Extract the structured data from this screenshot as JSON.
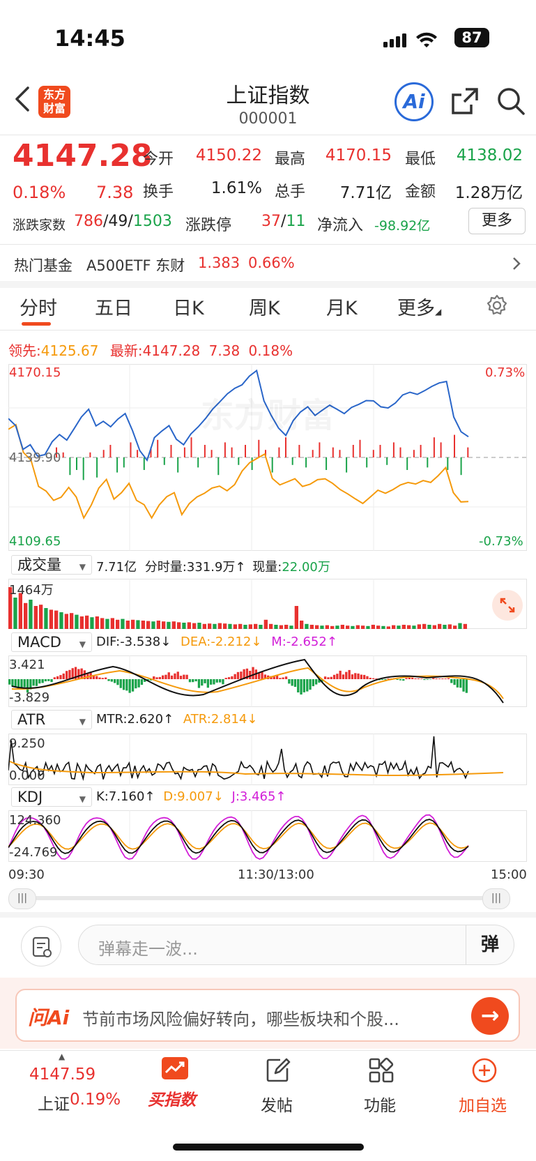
{
  "status": {
    "time": "14:45",
    "battery": "87"
  },
  "header": {
    "title": "上证指数",
    "code": "000001",
    "logo_line1": "东方",
    "logo_line2": "财富",
    "ai_label": "Ai"
  },
  "quote": {
    "price": "4147.28",
    "pct": "0.18%",
    "change": "7.38",
    "open_label": "今开",
    "open": "4150.22",
    "high_label": "最高",
    "high": "4170.15",
    "low_label": "最低",
    "low": "4138.02",
    "turnover_label": "换手",
    "turnover": "1.61%",
    "vol_label": "总手",
    "vol": "7.71亿",
    "amount_label": "金额",
    "amount": "1.28万亿",
    "breadth_label": "涨跌家数",
    "up": "786",
    "flat": "49",
    "down": "1503",
    "limit_label": "涨跌停",
    "limit_up": "37",
    "limit_down": "11",
    "netflow_label": "净流入",
    "netflow": "-98.92亿",
    "more_label": "更多"
  },
  "fund": {
    "label": "热门基金",
    "name": "A500ETF 东财",
    "price": "1.383",
    "pct": "0.66%"
  },
  "tabs": [
    "分时",
    "五日",
    "日K",
    "周K",
    "月K",
    "更多"
  ],
  "chart_header": {
    "lead_label": "领先:",
    "lead": "4125.67",
    "latest_label": "最新:",
    "latest": "4147.28",
    "change": "7.38",
    "pct": "0.18%"
  },
  "chart_data": {
    "type": "line",
    "title": "",
    "y_max": "4170.15",
    "y_min": "4109.65",
    "y_mid": "4139.90",
    "pct_max": "0.73%",
    "pct_min": "-0.73%",
    "ylim": [
      4109.65,
      4170.15
    ],
    "prev_close": 4139.9,
    "x_ticks": [
      "09:30",
      "11:30/13:00",
      "15:00"
    ],
    "series": [
      {
        "name": "最新",
        "color": "#2a66c9",
        "values": [
          4152.5,
          4150.2,
          4142.5,
          4144.0,
          4140.3,
          4140.8,
          4145.0,
          4147.3,
          4145.5,
          4149.2,
          4153.0,
          4155.5,
          4150.1,
          4151.6,
          4149.8,
          4152.3,
          4154.1,
          4148.6,
          4142.1,
          4139.0,
          4146.3,
          4148.4,
          4150.2,
          4145.8,
          4144.0,
          4147.5,
          4149.8,
          4152.5,
          4155.6,
          4158.0,
          4160.5,
          4162.3,
          4163.4,
          4166.2,
          4168.0,
          4158.2,
          4153.5,
          4149.4,
          4147.0,
          4151.8,
          4154.6,
          4156.3,
          4153.5,
          4155.2,
          4156.8,
          4155.5,
          4154.1,
          4156.1,
          4157.1,
          4158.3,
          4158.2,
          4156.3,
          4155.9,
          4157.5,
          4160.1,
          4161.0,
          4160.3,
          4161.5,
          4162.9,
          4164.0,
          4164.5,
          4153.0,
          4148.2,
          4146.6
        ]
      },
      {
        "name": "领先",
        "color": "#f59a0c",
        "values": [
          4149.0,
          4150.5,
          4141.5,
          4139.0,
          4130.5,
          4129.0,
          4126.0,
          4127.0,
          4130.2,
          4127.1,
          4120.3,
          4124.5,
          4130.0,
          4132.8,
          4126.4,
          4128.5,
          4131.5,
          4126.0,
          4124.6,
          4120.3,
          4124.5,
          4127.2,
          4128.5,
          4121.4,
          4125.0,
          4127.1,
          4128.3,
          4130.0,
          4130.6,
          4129.1,
          4131.1,
          4135.5,
          4138.2,
          4139.6,
          4141.0,
          4133.1,
          4131.0,
          4132.0,
          4133.0,
          4130.5,
          4131.2,
          4132.7,
          4133.0,
          4131.5,
          4129.5,
          4128.1,
          4126.5,
          4125.0,
          4127.1,
          4129.3,
          4128.3,
          4129.5,
          4131.0,
          4131.8,
          4131.3,
          4132.4,
          4131.8,
          4134.0,
          4136.6,
          4128.5,
          4125.5,
          4125.6
        ]
      }
    ],
    "flow_bars": [
      0.4,
      0.2,
      -0.7,
      -0.5,
      -0.9,
      0.2,
      -0.8,
      0.3,
      0.5,
      -0.6,
      -0.4,
      0.6,
      0.3,
      -0.5,
      0.4,
      0.7,
      -0.3,
      0.5,
      -0.6,
      0.4,
      0.8,
      -0.4,
      0.5,
      0.3,
      -0.7,
      0.6,
      0.4,
      -0.3,
      0.5,
      -0.5,
      0.7,
      0.3,
      -0.6,
      0.4,
      0.8,
      -0.3,
      0.5,
      -0.4,
      0.3,
      0.6,
      -0.5,
      0.4,
      0.3,
      -0.6,
      0.5,
      0.7,
      -0.4,
      0.3,
      0.5,
      -0.3,
      0.6,
      0.4,
      -0.5,
      0.3,
      0.5,
      -0.4,
      0.8,
      0.6,
      -0.5,
      0.9,
      -0.7,
      0.4
    ]
  },
  "volume": {
    "select": "成交量",
    "total": "7.71亿",
    "label_minute": "分时量:",
    "minute": "331.9万",
    "label_now": "现量:",
    "now": "22.00万",
    "max_label": "1464万",
    "bars": [
      1.0,
      0.75,
      0.86,
      0.62,
      0.7,
      0.55,
      0.58,
      0.5,
      0.46,
      0.44,
      0.4,
      0.36,
      0.38,
      0.34,
      0.3,
      0.32,
      0.28,
      0.3,
      0.26,
      0.24,
      0.26,
      0.22,
      0.24,
      0.2,
      0.22,
      0.21,
      0.2,
      0.19,
      0.18,
      0.2,
      0.18,
      0.17,
      0.18,
      0.16,
      0.15,
      0.16,
      0.14,
      0.15,
      0.12,
      0.13,
      0.12,
      0.14,
      0.13,
      0.12,
      0.11,
      0.12,
      0.1,
      0.11,
      0.12,
      0.1,
      0.22,
      0.12,
      0.1,
      0.09,
      0.1,
      0.08,
      0.55,
      0.2,
      0.12,
      0.1,
      0.09,
      0.08,
      0.09,
      0.07,
      0.08,
      0.1,
      0.08,
      0.07,
      0.09,
      0.08,
      0.07,
      0.1,
      0.08,
      0.07,
      0.06,
      0.09,
      0.08,
      0.1,
      0.09,
      0.08,
      0.11,
      0.12,
      0.1,
      0.09,
      0.12,
      0.1,
      0.11,
      0.08,
      0.14,
      0.12
    ]
  },
  "macd": {
    "select": "MACD",
    "dif": "DIF:-3.538",
    "dea": "DEA:-2.212",
    "m": "M:-2.652",
    "top": "3.421",
    "bottom": "-3.829",
    "hist": [
      -0.5,
      -0.7,
      -0.9,
      -0.6,
      -0.3,
      0.3,
      0.6,
      0.8,
      0.7,
      0.5,
      0.2,
      -0.3,
      -0.7,
      -0.9,
      -0.6,
      -0.2,
      0.3,
      0.6,
      0.5,
      0.3,
      -0.2,
      -0.6,
      -0.8,
      -0.5,
      0.2,
      0.5,
      0.7,
      0.8,
      0.6,
      0.4,
      0.2,
      -0.5,
      -1.0,
      -0.8,
      -0.4,
      0.3,
      0.7,
      0.6,
      0.4,
      0.3,
      0.1,
      -0.1,
      0.1,
      -0.1,
      0.1,
      0.05,
      -0.05,
      0.1,
      0.1,
      -0.6,
      -0.9
    ]
  },
  "atr": {
    "select": "ATR",
    "mtr": "MTR:2.620",
    "atr": "ATR:2.814",
    "top": "9.250",
    "bottom": "0.000"
  },
  "kdj": {
    "select": "KDJ",
    "k": "K:7.160",
    "d": "D:9.007",
    "j": "J:3.465",
    "top": "124.360",
    "bottom": "-24.769"
  },
  "comment": {
    "placeholder": "弹幕走一波...",
    "danmu": "弹"
  },
  "ask": {
    "logo": "问Ai",
    "text": "节前市场风险偏好转向，哪些板块和个股..."
  },
  "nav": {
    "index_value": "4147.59",
    "index_name": "上证",
    "index_pct": "0.19%",
    "buy": "买指数",
    "post": "发帖",
    "func": "功能",
    "watch": "加自选"
  },
  "colors": {
    "up": "#e8312f",
    "down": "#1aa34a",
    "accent": "#f04a1e",
    "price_line": "#2a66c9",
    "lead_line": "#f59a0c",
    "magenta": "#d21fd8"
  }
}
